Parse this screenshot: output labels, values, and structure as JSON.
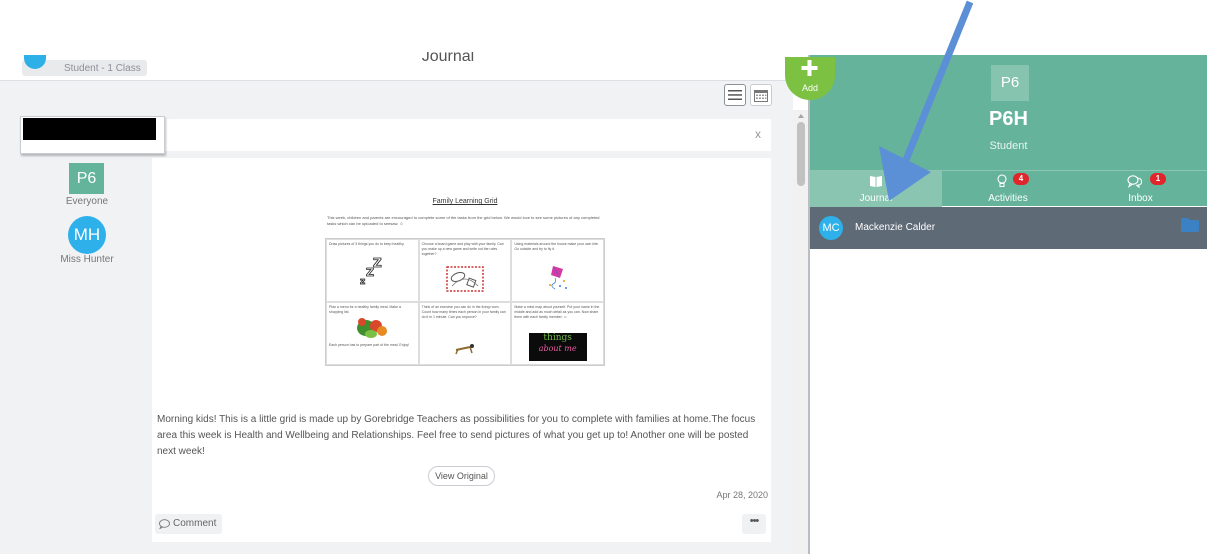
{
  "header": {
    "class_pill": "Student - 1 Class",
    "title": "Journal"
  },
  "filter": {
    "close_label": "x"
  },
  "sidebar": {
    "class_tile": "P6",
    "everyone_label": "Everyone",
    "teacher_initials": "MH",
    "teacher_name": "Miss Hunter"
  },
  "post": {
    "grid_title": "Family Learning Grid",
    "grid_intro": "This week, children and parents are encouraged to complete some of the tasks from the grid below. We would love to see some pictures of any completed tasks which can be uploaded to seesaw. ☺",
    "grid_cells": [
      "Draw pictures of 3 things you do to keep healthy.",
      "Choose a board game and play with your family. Can you make up a new game and write out the rules together?",
      "Using materials around the house make your own kite. Go outside and try to fly it.",
      "Plan a menu for a healthy family meal. Make a shopping list.",
      "Think of an exercise you can do in the living room. Count how many times each person in your family can do it in 1 minute. Can you improve?",
      "Make a mind map about yourself. Put your name in the middle and add as much detail as you can. Now share them with each family member. ☺"
    ],
    "cell_footer": "Each person has to prepare part of the meal. Enjoy!",
    "things_line1": "things",
    "things_line2": "about me",
    "text": "Morning kids! This is a little grid is made up by Gorebridge Teachers as possibilities for you to complete with families at home.The focus area this week is Health and Wellbeing and Relationships. Feel free to send pictures of what you get up to! Another one will be posted next week!",
    "view_original": "View Original",
    "date": "Apr 28, 2020",
    "comment_label": "Comment",
    "more_label": "•••"
  },
  "right_panel": {
    "add_label": "Add",
    "class_tile": "P6",
    "name": "P6H",
    "role": "Student",
    "tabs": [
      {
        "label": "Journal",
        "icon": "book-icon"
      },
      {
        "label": "Activities",
        "icon": "lightbulb-icon",
        "badge": "4"
      },
      {
        "label": "Inbox",
        "icon": "chat-bubbles-icon",
        "badge": "1"
      }
    ],
    "student": {
      "initials": "MC",
      "name": "Mackenzie Calder"
    }
  },
  "colors": {
    "brand_green": "#66b39b",
    "avatar_blue": "#2eb1ea",
    "badge_red": "#e0262b",
    "annotation_arrow": "#5b8fd6"
  }
}
